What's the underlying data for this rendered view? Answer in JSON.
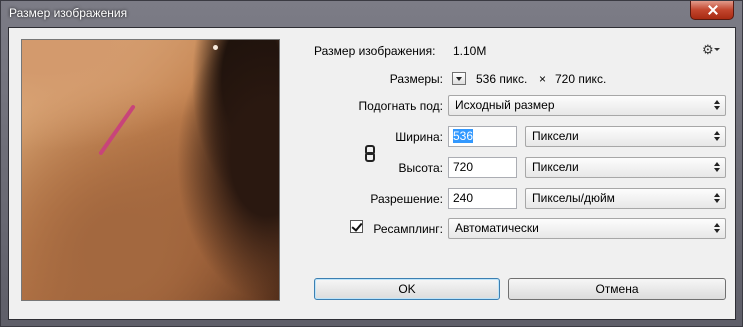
{
  "window": {
    "title": "Размер изображения"
  },
  "image_size": {
    "label": "Размер изображения:",
    "value": "1.10M"
  },
  "dimensions": {
    "label": "Размеры:",
    "width_value": "536 пикс.",
    "times": "×",
    "height_value": "720 пикс."
  },
  "fit_to": {
    "label": "Подогнать под:",
    "value": "Исходный размер"
  },
  "width": {
    "label": "Ширина:",
    "value": "536",
    "unit": "Пиксели"
  },
  "height": {
    "label": "Высота:",
    "value": "720",
    "unit": "Пиксели"
  },
  "resolution": {
    "label": "Разрешение:",
    "value": "240",
    "unit": "Пикселы/дюйм"
  },
  "resample": {
    "label": "Ресамплинг:",
    "checked": true,
    "value": "Автоматически"
  },
  "buttons": {
    "ok": "OK",
    "cancel": "Отмена"
  },
  "icons": {
    "gear": "gear-icon",
    "link": "link-icon",
    "close": "close-icon"
  }
}
